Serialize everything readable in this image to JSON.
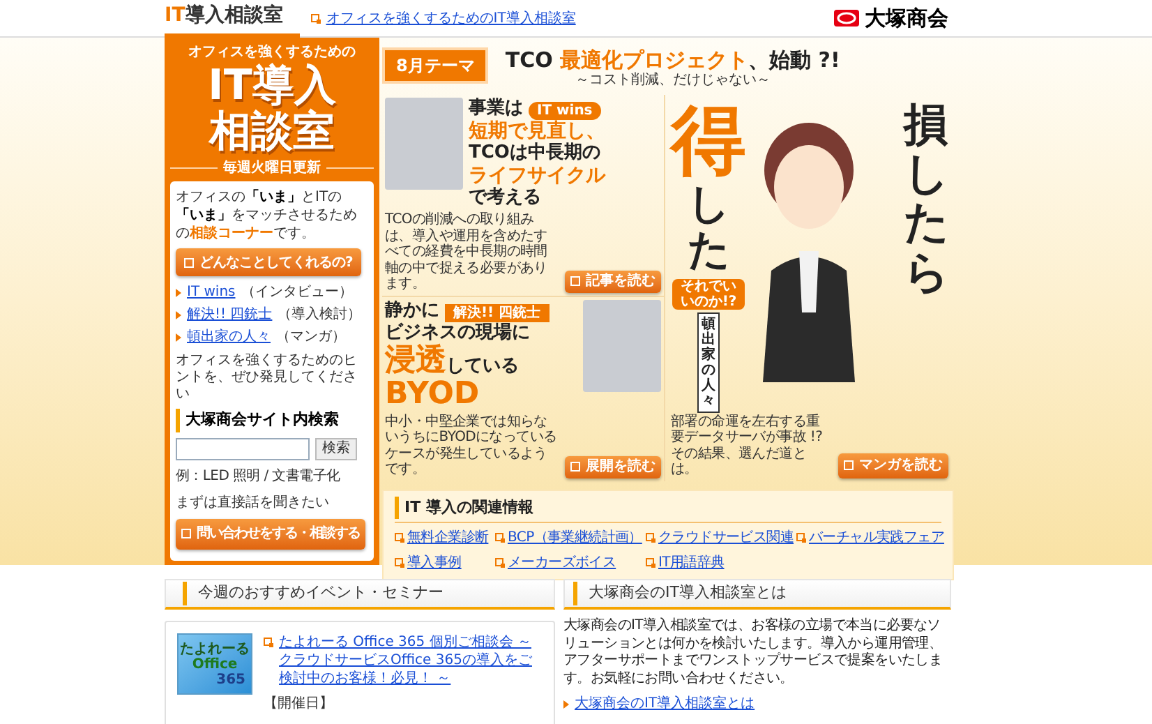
{
  "header": {
    "logo_prefix": "IT",
    "logo_suffix": "導入相談室",
    "tagline_link": "オフィスを強くするためのIT導入相談室",
    "brand": "大塚商会"
  },
  "sidebar": {
    "kicker": "オフィスを強くするための",
    "title_lines": [
      "IT導入",
      "相談室"
    ],
    "update_note": "毎週火曜日更新",
    "intro": [
      {
        "text": "オフィスの",
        "kind": "plain"
      },
      {
        "text": "「いま」",
        "kind": "bold"
      },
      {
        "text": "とITの",
        "kind": "plain"
      },
      {
        "text": "「いま」",
        "kind": "bold"
      },
      {
        "text": "をマッチさせるための",
        "kind": "plain"
      },
      {
        "text": "相談コーナー",
        "kind": "accent"
      },
      {
        "text": "です。",
        "kind": "plain"
      }
    ],
    "about_button": "どんなことしてくれるの?",
    "links": [
      {
        "link": "IT wins",
        "note": "（インタビュー）"
      },
      {
        "link": "解決!! 四銃士",
        "note": "（導入検討）"
      },
      {
        "link": "頓出家の人々",
        "note": "（マンガ）"
      }
    ],
    "hint": "オフィスを強くするためのヒントを、ぜひ発見してください",
    "search_heading": "大塚商会サイト内検索",
    "search_button": "検索",
    "search_example": "例：LED 照明 / 文書電子化",
    "contact_lead": "まずは直接話を聞きたい",
    "contact_button": "問い合わせをする・相談する"
  },
  "theme": {
    "badge": "8月テーマ",
    "title_prefix": "TCO ",
    "title_accent": "最適化プロジェクト",
    "title_suffix": "、始動 ?!",
    "subtitle": "～コスト削減、だけじゃない～"
  },
  "cards": [
    {
      "tag": "IT wins",
      "lines": [
        [
          {
            "text": "事業は",
            "accent": false
          }
        ],
        [
          {
            "text": "短期で見直し、",
            "accent": true
          }
        ],
        [
          {
            "text": "TCOは中長期の",
            "accent": false
          }
        ],
        [
          {
            "text": "ライフサイクル",
            "accent": true
          }
        ],
        [
          {
            "text": "で考える",
            "accent": false
          }
        ]
      ],
      "description": "TCOの削減への取り組みは、導入や運用を含めたすべての経費を中長期の時間軸の中で捉える必要があります。",
      "button": "記事を読む"
    },
    {
      "tag": "解決!! 四銃士",
      "lines": [
        [
          {
            "text": "静かに",
            "accent": false
          }
        ],
        [
          {
            "text": "ビジネスの現場に",
            "accent": false
          }
        ],
        [
          {
            "text": "浸透",
            "accent": true
          },
          {
            "text": "している",
            "accent": false
          }
        ],
        [
          {
            "text": "BYOD",
            "accent": true
          }
        ]
      ],
      "description": "中小・中堅企業では知らないうちにBYODになっているケースが発生しているようです。",
      "button": "展開を読む"
    }
  ],
  "manga": {
    "big_accent": "得",
    "big_left": "した",
    "big_right": "損したら",
    "badge": "それでいいのか!?",
    "series": "頓出家の人々",
    "description": "部署の命運を左右する重要データサーバが事故 !? その結果、選んだ道とは。",
    "button": "マンガを読む"
  },
  "related": {
    "heading": "IT 導入の関連情報",
    "links": [
      "無料企業診断",
      "BCP（事業継続計画）",
      "クラウドサービス関連",
      "バーチャル実践フェア",
      "導入事例",
      "メーカーズボイス",
      "IT用語辞典"
    ]
  },
  "events": {
    "heading": "今週のおすすめイベント・セミナー",
    "logo_lines": [
      "たよれーる",
      "Office",
      "365"
    ],
    "link": "たよれーる Office 365 個別ご相談会 ～クラウドサービスOffice 365の導入をご検討中のお客様！必見！ ～",
    "date_label": "【開催日】"
  },
  "about": {
    "heading": "大塚商会のIT導入相談室とは",
    "body": "大塚商会のIT導入相談室では、お客様の立場で本当に必要なソリューションとは何かを検討いたします。導入から運用管理、アフターサポートまでワンストップサービスで提案をいたします。お気軽にお問い合わせください。",
    "link": "大塚商会のIT導入相談室とは"
  }
}
